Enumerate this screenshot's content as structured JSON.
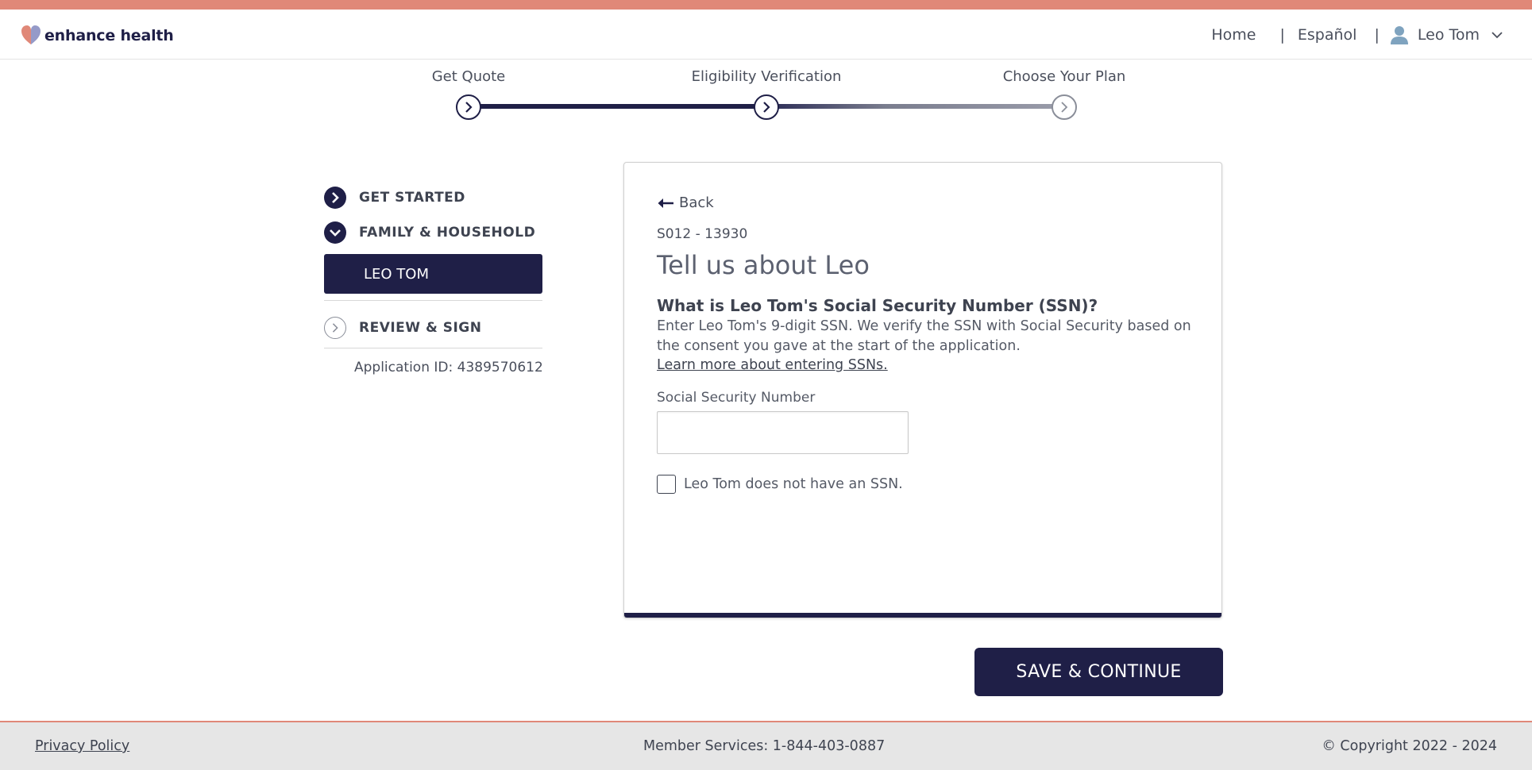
{
  "header": {
    "brand": "enhance health",
    "nav_home": "Home",
    "nav_espanol": "Español",
    "separator": "|",
    "user_name": "Leo Tom"
  },
  "progress": {
    "steps": [
      {
        "label": "Get Quote",
        "state": "complete"
      },
      {
        "label": "Eligibility Verification",
        "state": "current"
      },
      {
        "label": "Choose Your Plan",
        "state": "upcoming"
      }
    ]
  },
  "sidebar": {
    "get_started": "GET STARTED",
    "family_household": "FAMILY & HOUSEHOLD",
    "active_member": "LEO TOM",
    "review_sign": "REVIEW & SIGN",
    "application_id": "Application ID: 4389570612"
  },
  "card": {
    "back_label": "Back",
    "plan_code": "S012 - 13930",
    "title": "Tell us about Leo",
    "question": "What is Leo Tom's Social Security Number (SSN)?",
    "helper": "Enter Leo Tom's 9-digit SSN. We verify the SSN with Social Security based on the consent you gave at the start of the application.",
    "learn_more": "Learn more about entering SSNs.",
    "ssn_label": "Social Security Number",
    "ssn_value": "",
    "no_ssn_label": "Leo Tom does not have an SSN.",
    "no_ssn_checked": false
  },
  "actions": {
    "save_continue": "SAVE & CONTINUE"
  },
  "footer": {
    "privacy": "Privacy Policy",
    "member_services": "Member Services: 1-844-403-0887",
    "copyright": "© Copyright 2022 - 2024"
  },
  "colors": {
    "navy": "#1f1f47",
    "accent": "#e08878",
    "text": "#555a66"
  }
}
